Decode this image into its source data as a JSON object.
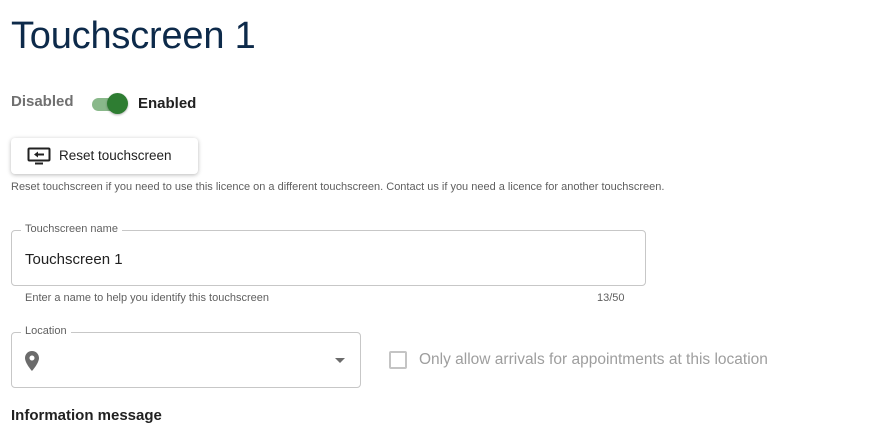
{
  "page": {
    "title": "Touchscreen 1"
  },
  "status": {
    "disabled_label": "Disabled",
    "enabled_label": "Enabled",
    "enabled": true,
    "toggle_color": "#2e7d32"
  },
  "reset": {
    "button_label": "Reset touchscreen",
    "icon": "reset-screen-icon",
    "help_text": "Reset touchscreen if you need to use this licence on a different touchscreen. Contact us if you need a licence for another touchscreen."
  },
  "name_field": {
    "label": "Touchscreen name",
    "value": "Touchscreen 1",
    "helper": "Enter a name to help you identify this touchscreen",
    "counter": "13/50"
  },
  "location_field": {
    "label": "Location",
    "value": "",
    "icon": "location-pin-icon",
    "dropdown_icon": "caret-down-icon"
  },
  "arrivals_checkbox": {
    "label": "Only allow arrivals for appointments at this location",
    "checked": false,
    "disabled": true
  },
  "information": {
    "heading": "Information message"
  },
  "colors": {
    "title": "#0d2a4a",
    "accent_green": "#2e7d32",
    "muted_text": "#5f5f5f"
  }
}
